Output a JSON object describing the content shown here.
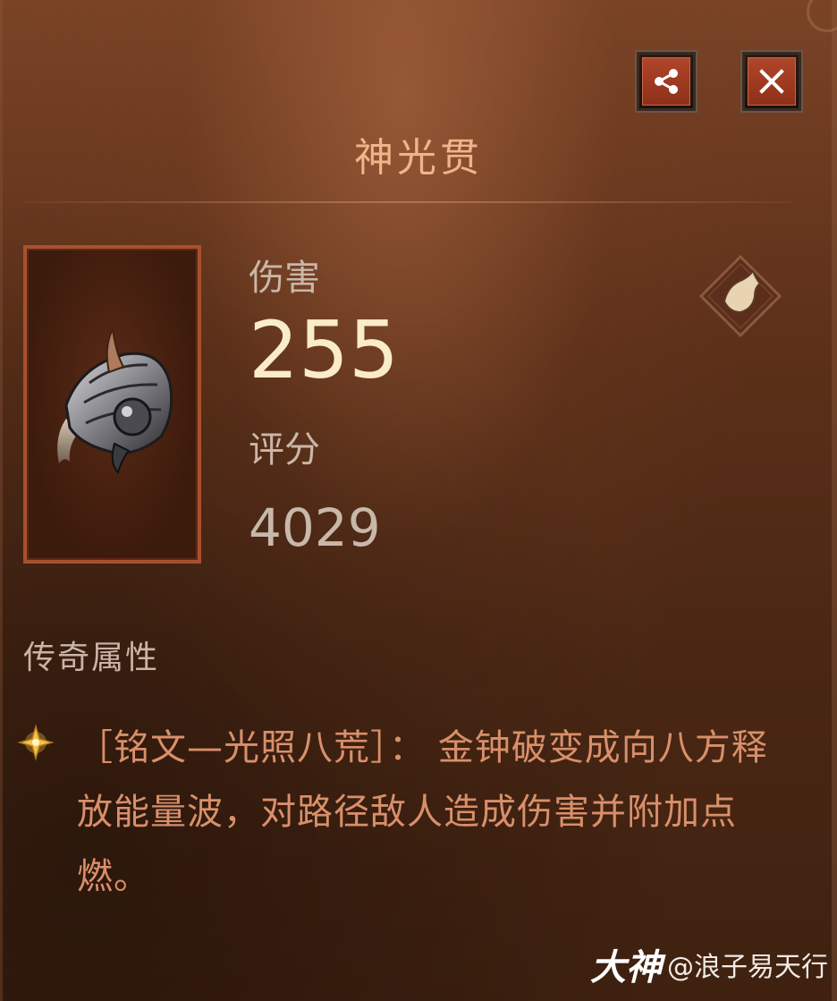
{
  "header": {
    "title": "神光贯",
    "share_icon": "share-icon",
    "close_icon": "close-icon"
  },
  "item": {
    "icon": "gauntlet-icon",
    "weapon_type_icon": "fist-weapon-icon"
  },
  "stats": {
    "damage_label": "伤害",
    "damage_value": "255",
    "score_label": "评分",
    "score_value": "4029"
  },
  "legendary": {
    "section_title": "传奇属性",
    "bullet_icon": "star-bullet-icon",
    "description": "［铭文—光照八荒］： 金钟破变成向八方释放能量波，对路径敌人造成伤害并附加点燃。"
  },
  "watermark": {
    "logo": "大神",
    "user": "@浪子易天行"
  },
  "colors": {
    "title": "#f1b48a",
    "damage_value": "#fbecc9",
    "description": "#d98f6a",
    "button_red": "#b0452a"
  }
}
